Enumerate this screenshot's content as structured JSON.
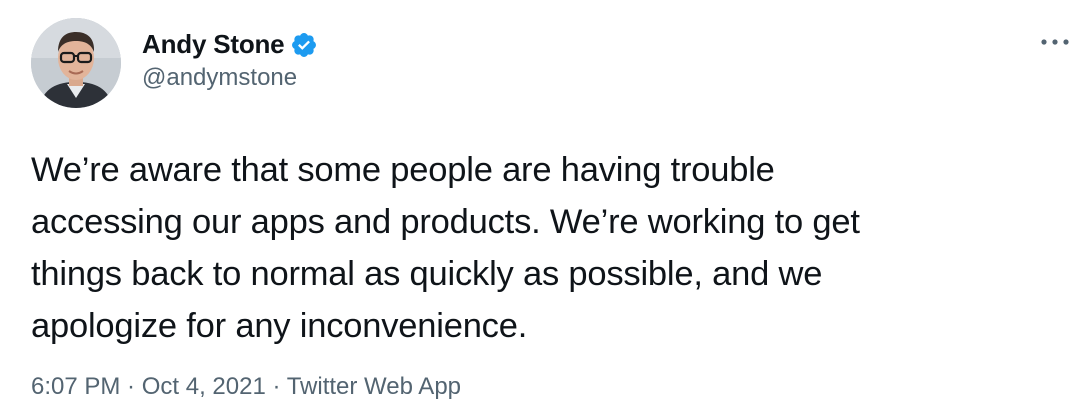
{
  "author": {
    "display_name": "Andy Stone",
    "handle": "@andymstone",
    "verified": true
  },
  "tweet": {
    "lines": [
      "We’re aware that some people are having trouble",
      "accessing our apps and products. We’re working to get",
      "things back to normal as quickly as possible, and we",
      "apologize for any inconvenience."
    ]
  },
  "meta": {
    "time": "6:07 PM",
    "separator": " · ",
    "date": "Oct 4, 2021",
    "source": "Twitter Web App"
  },
  "icons": {
    "verified": "verified-badge-icon",
    "more": "more-horizontal-icon"
  },
  "colors": {
    "text": "#0f1419",
    "secondary": "#536471",
    "verified_blue": "#1d9bf0"
  }
}
